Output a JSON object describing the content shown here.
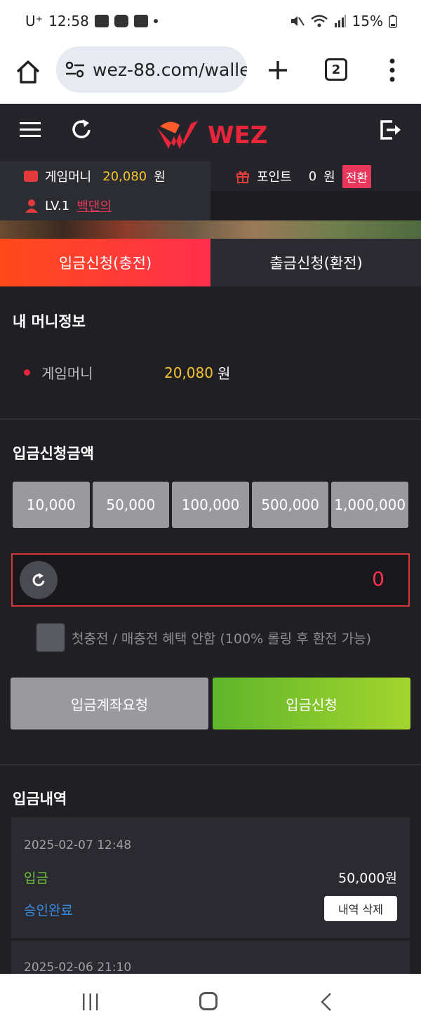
{
  "status_bar": {
    "carrier": "U⁺",
    "time": "12:58",
    "battery": "15%",
    "icons": [
      "gallery-icon",
      "youtube-icon",
      "b-app-icon",
      "mute-icon",
      "wifi-icon",
      "signal-icon",
      "battery-icon"
    ]
  },
  "browser": {
    "url": "wez-88.com/walle",
    "tab_count": "2"
  },
  "header": {
    "logo_text": "WEZ"
  },
  "info": {
    "game_money_label": "게임머니",
    "game_money_value": "20,080",
    "won": "원",
    "point_label": "포인트",
    "point_value": "0",
    "switch_label": "전환",
    "level": "LV.1",
    "nickname": "백댄의"
  },
  "tabs": [
    {
      "label": "입금신청(충전)",
      "active": true
    },
    {
      "label": "출금신청(환전)",
      "active": false
    }
  ],
  "money_info": {
    "title": "내 머니정보",
    "label": "게임머니",
    "value": "20,080",
    "unit": "원"
  },
  "deposit": {
    "title": "입금신청금액",
    "amount_buttons": [
      "10,000",
      "50,000",
      "100,000",
      "500,000",
      "1,000,000"
    ],
    "amount_value": "0",
    "checkbox_label": "첫충전 / 매충전 혜택 안함 (100% 롤링 후 환전 가능)",
    "account_request_label": "입금계좌요청",
    "submit_label": "입금신청"
  },
  "history": {
    "title": "입금내역",
    "items": [
      {
        "date": "2025-02-07 12:48",
        "type": "입금",
        "amount": "50,000원",
        "status": "승인완료",
        "delete_label": "내역 삭제"
      },
      {
        "date": "2025-02-06 21:10"
      }
    ]
  },
  "colors": {
    "accent_red": "#e8375a",
    "money_yellow": "#f4c430",
    "tab_active": "#ff3a30",
    "deposit_green": "#7cc42c",
    "status_blue": "#3a8fe8"
  }
}
